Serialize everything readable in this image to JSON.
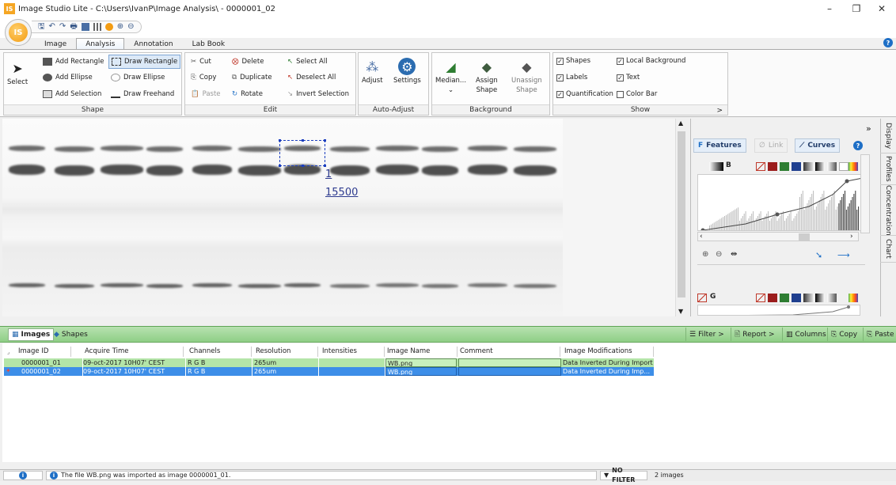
{
  "window": {
    "title": "Image Studio Lite - C:\\Users\\IvanP\\Image Analysis\\ - 0000001_02",
    "app_badge": "IS",
    "minimize": "–",
    "restore": "❐",
    "close": "✕"
  },
  "qat": {
    "save": "🖫",
    "undo": "↶",
    "redo": "↷",
    "print": "🖶",
    "zoom_in": "⊕",
    "zoom_out": "⊖"
  },
  "tabs": [
    {
      "label": "Image"
    },
    {
      "label": "Analysis"
    },
    {
      "label": "Annotation"
    },
    {
      "label": "Lab Book"
    }
  ],
  "active_tab": "Analysis",
  "help": "?",
  "ribbon": {
    "select": "Select",
    "shape": {
      "label": "Shape",
      "add_rectangle": "Add Rectangle",
      "draw_rectangle": "Draw Rectangle",
      "add_ellipse": "Add Ellipse",
      "draw_ellipse": "Draw Ellipse",
      "add_selection": "Add Selection",
      "draw_freehand": "Draw Freehand"
    },
    "edit": {
      "label": "Edit",
      "cut": "Cut",
      "copy": "Copy",
      "paste": "Paste",
      "delete": "Delete",
      "duplicate": "Duplicate",
      "rotate": "Rotate",
      "select_all": "Select All",
      "deselect_all": "Deselect All",
      "invert_selection": "Invert Selection"
    },
    "auto_adjust": {
      "label": "Auto-Adjust",
      "adjust": "Adjust",
      "settings": "Settings"
    },
    "background": {
      "label": "Background",
      "median": "Median...",
      "assign_1": "Assign",
      "assign_2": "Shape",
      "unassign_1": "Unassign",
      "unassign_2": "Shape"
    },
    "show": {
      "label": "Show",
      "shapes": "Shapes",
      "labels": "Labels",
      "quantification": "Quantification",
      "local_background": "Local Background",
      "text": "Text",
      "color_bar": "Color Bar",
      "more": ">"
    }
  },
  "image": {
    "shape_label": "1",
    "shape_value": "15500"
  },
  "side_panel": {
    "features": "Features",
    "link": "Link",
    "curves": "Curves",
    "expand": "»",
    "channel_b": "B",
    "channel_g": "G",
    "colors": [
      "#9b1d1d",
      "#2e7d32",
      "#1f3f8f",
      "#6b6b6b",
      "#bdbdbd"
    ]
  },
  "vertical_tabs": [
    "Display",
    "Profiles",
    "Concentration",
    "Chart"
  ],
  "bottom": {
    "tab_images": "Images",
    "tab_shapes": "Shapes",
    "filter": "Filter >",
    "report": "Report >",
    "columns": "Columns",
    "copy": "Copy",
    "paste": "Paste",
    "columns_list": [
      "Image ID",
      "Acquire Time",
      "Channels",
      "Resolution",
      "Intensities",
      "Image Name",
      "Comment",
      "Image Modifications"
    ],
    "rows": [
      {
        "id": "0000001_01",
        "time": "09-oct-2017 10H07' CEST",
        "channels": "R G B",
        "resolution": "265um",
        "intensities": "",
        "name": "WB.png",
        "comment": "",
        "mods": "Data Inverted During Import"
      },
      {
        "id": "0000001_02",
        "time": "09-oct-2017 10H07' CEST",
        "channels": "R G B",
        "resolution": "265um",
        "intensities": "",
        "name": "WB.png",
        "comment": "",
        "mods": "Data Inverted During Imp..."
      }
    ]
  },
  "status": {
    "message": "The file WB.png was imported as image 0000001_01.",
    "filter": "NO FILTER",
    "count": "2 images"
  }
}
